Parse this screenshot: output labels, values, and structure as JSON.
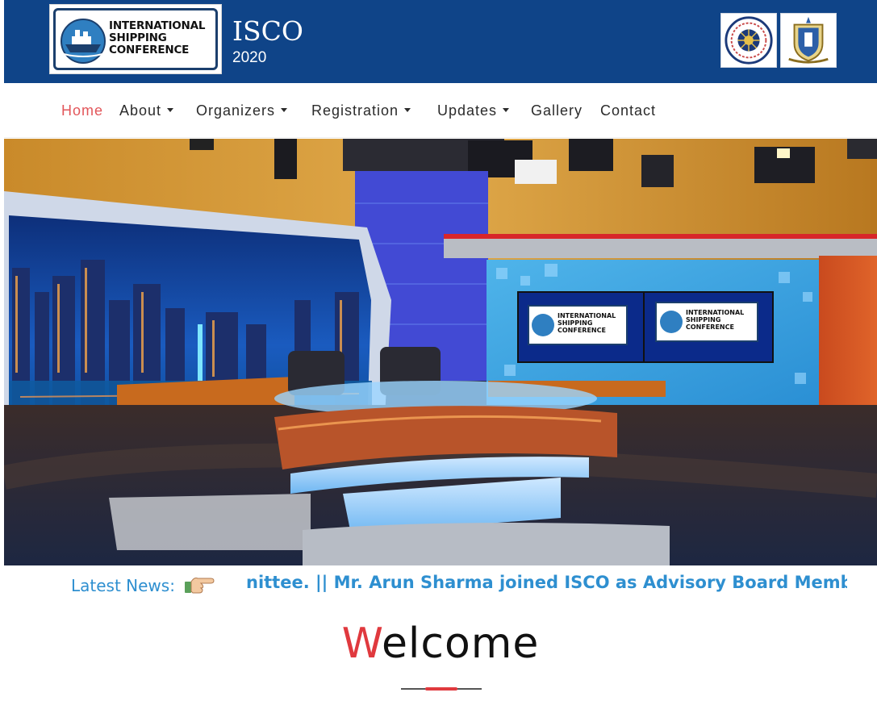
{
  "header": {
    "logo_lines": [
      "INTERNATIONAL",
      "SHIPPING",
      "CONFERENCE"
    ],
    "title": "ISCO",
    "year": "2020",
    "background_color": "#0f4488"
  },
  "nav": {
    "items": [
      {
        "label": "Home",
        "active": true,
        "has_dropdown": false
      },
      {
        "label": "About",
        "active": false,
        "has_dropdown": true
      },
      {
        "label": "Organizers",
        "active": false,
        "has_dropdown": true
      },
      {
        "label": "Registration",
        "active": false,
        "has_dropdown": true
      },
      {
        "label": "Updates",
        "active": false,
        "has_dropdown": true
      },
      {
        "label": "Gallery",
        "active": false,
        "has_dropdown": false
      },
      {
        "label": "Contact",
        "active": false,
        "has_dropdown": false
      }
    ],
    "active_color": "#e2565a"
  },
  "hero": {
    "screen_logo_lines": [
      "INTERNATIONAL",
      "SHIPPING",
      "CONFERENCE"
    ]
  },
  "ticker": {
    "label": "Latest News:",
    "text": "nittee. || Mr. Arun Sharma joined ISCO as Advisory Board Member",
    "icon": "pointing-hand-icon",
    "color": "#2e8fd0"
  },
  "welcome": {
    "first_letter": "W",
    "rest": "elcome",
    "accent_color": "#e0393e"
  }
}
